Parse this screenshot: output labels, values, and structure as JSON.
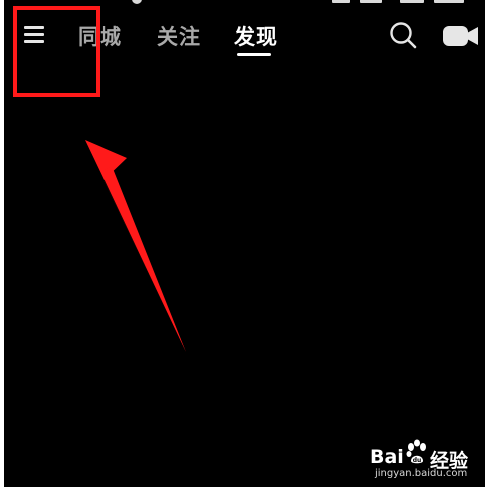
{
  "header": {
    "tabs": [
      {
        "label": "同城",
        "active": false
      },
      {
        "label": "关注",
        "active": false
      },
      {
        "label": "发现",
        "active": true
      }
    ],
    "icons": {
      "menu": "menu-icon",
      "search": "search-icon",
      "camera": "camera-icon"
    }
  },
  "annotation": {
    "highlight_color": "#ff1a1a",
    "arrow_color": "#ff1a1a"
  },
  "watermark": {
    "brand": "Bai",
    "brand_suffix": "经验",
    "url": "jingyan.baidu.com"
  }
}
